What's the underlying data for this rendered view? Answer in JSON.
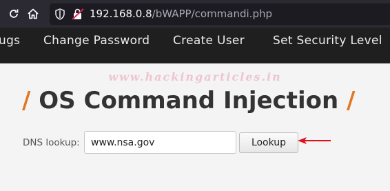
{
  "browser": {
    "url_host": "192.168.0.8",
    "url_path": "/bWAPP/commandi.php"
  },
  "menu": {
    "items": [
      {
        "label": "ugs"
      },
      {
        "label": "Change Password"
      },
      {
        "label": "Create User"
      },
      {
        "label": "Set Security Level"
      }
    ]
  },
  "watermark": "www.hackingarticles.in",
  "page": {
    "title_slash": "/",
    "title": "OS Command Injection"
  },
  "form": {
    "dns_label": "DNS lookup:",
    "dns_value": "www.nsa.gov",
    "lookup_label": "Lookup"
  },
  "colors": {
    "accent": "#e07727",
    "menu_bg": "#1f1f1f",
    "annotation_arrow": "#e0101a"
  },
  "icons": [
    "refresh-icon",
    "home-icon",
    "shield-icon",
    "insecure-lock-icon",
    "red-arrow-icon"
  ]
}
